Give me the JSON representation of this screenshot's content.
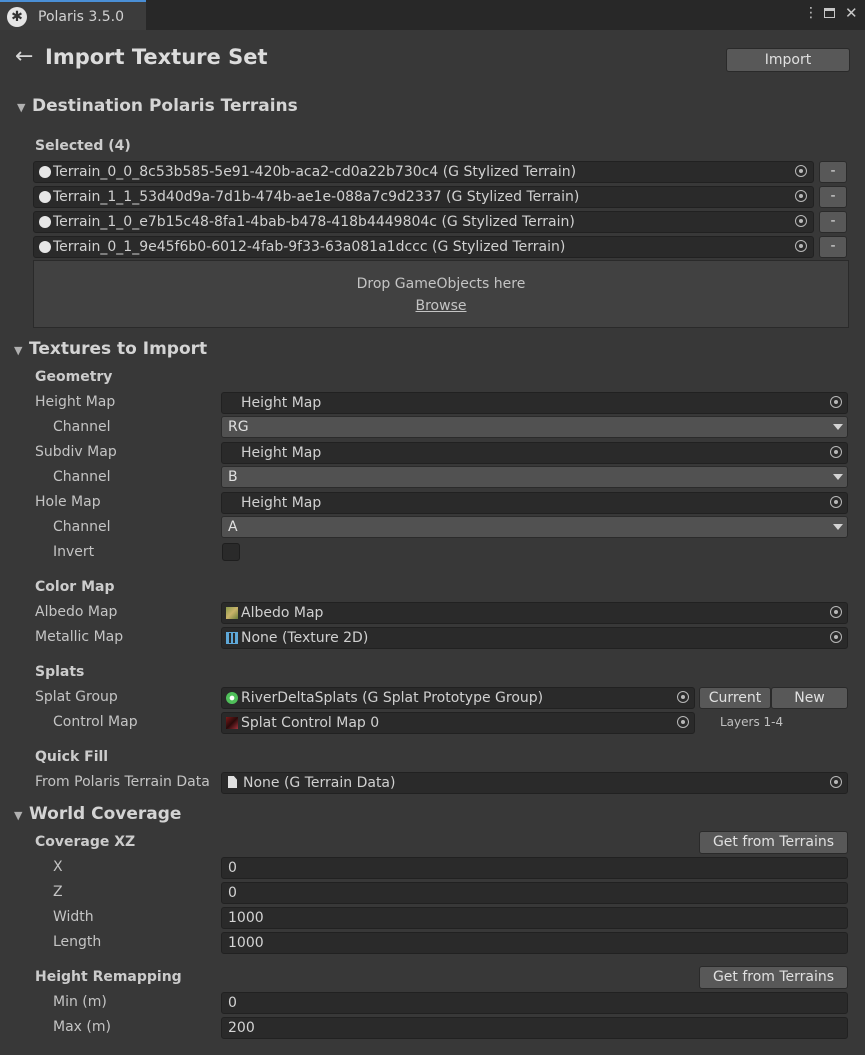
{
  "window": {
    "tab_title": "Polaris 3.5.0"
  },
  "header": {
    "title": "Import Texture Set",
    "import_label": "Import"
  },
  "destination": {
    "title": "Destination Polaris Terrains",
    "selected_label": "Selected (4)",
    "terrains": [
      "Terrain_0_0_8c53b585-5e91-420b-aca2-cd0a22b730c4 (G Stylized Terrain)",
      "Terrain_1_1_53d40d9a-7d1b-474b-ae1e-088a7c9d2337 (G Stylized Terrain)",
      "Terrain_1_0_e7b15c48-8fa1-4bab-b478-418b4449804c (G Stylized Terrain)",
      "Terrain_0_1_9e45f6b0-6012-4fab-9f33-63a081a1dccc (G Stylized Terrain)"
    ],
    "remove_label": "-",
    "drop_text": "Drop GameObjects here",
    "browse_label": "Browse"
  },
  "textures": {
    "title": "Textures to Import",
    "geometry_label": "Geometry",
    "height_map_label": "Height Map",
    "height_map_value": "Height Map",
    "channel_label": "Channel",
    "height_channel": "RG",
    "subdiv_map_label": "Subdiv Map",
    "subdiv_map_value": "Height Map",
    "subdiv_channel": "B",
    "hole_map_label": "Hole Map",
    "hole_map_value": "Height Map",
    "hole_channel": "A",
    "invert_label": "Invert",
    "color_map_label": "Color Map",
    "albedo_label": "Albedo Map",
    "albedo_value": "Albedo Map",
    "metallic_label": "Metallic Map",
    "metallic_value": "None (Texture 2D)",
    "splats_label": "Splats",
    "splat_group_label": "Splat Group",
    "splat_group_value": "RiverDeltaSplats (G Splat Prototype Group)",
    "current_label": "Current",
    "new_label": "New",
    "control_map_label": "Control Map",
    "control_map_value": "Splat Control Map 0",
    "layers_label": "Layers 1-4",
    "quick_fill_label": "Quick Fill",
    "from_data_label": "From Polaris Terrain Data",
    "from_data_value": "None (G Terrain Data)"
  },
  "world": {
    "title": "World Coverage",
    "coverage_label": "Coverage XZ",
    "get_from_terrains": "Get from Terrains",
    "x_label": "X",
    "x_value": "0",
    "z_label": "Z",
    "z_value": "0",
    "width_label": "Width",
    "width_value": "1000",
    "length_label": "Length",
    "length_value": "1000",
    "height_remap_label": "Height Remapping",
    "min_label": "Min (m)",
    "min_value": "0",
    "max_label": "Max (m)",
    "max_value": "200"
  }
}
